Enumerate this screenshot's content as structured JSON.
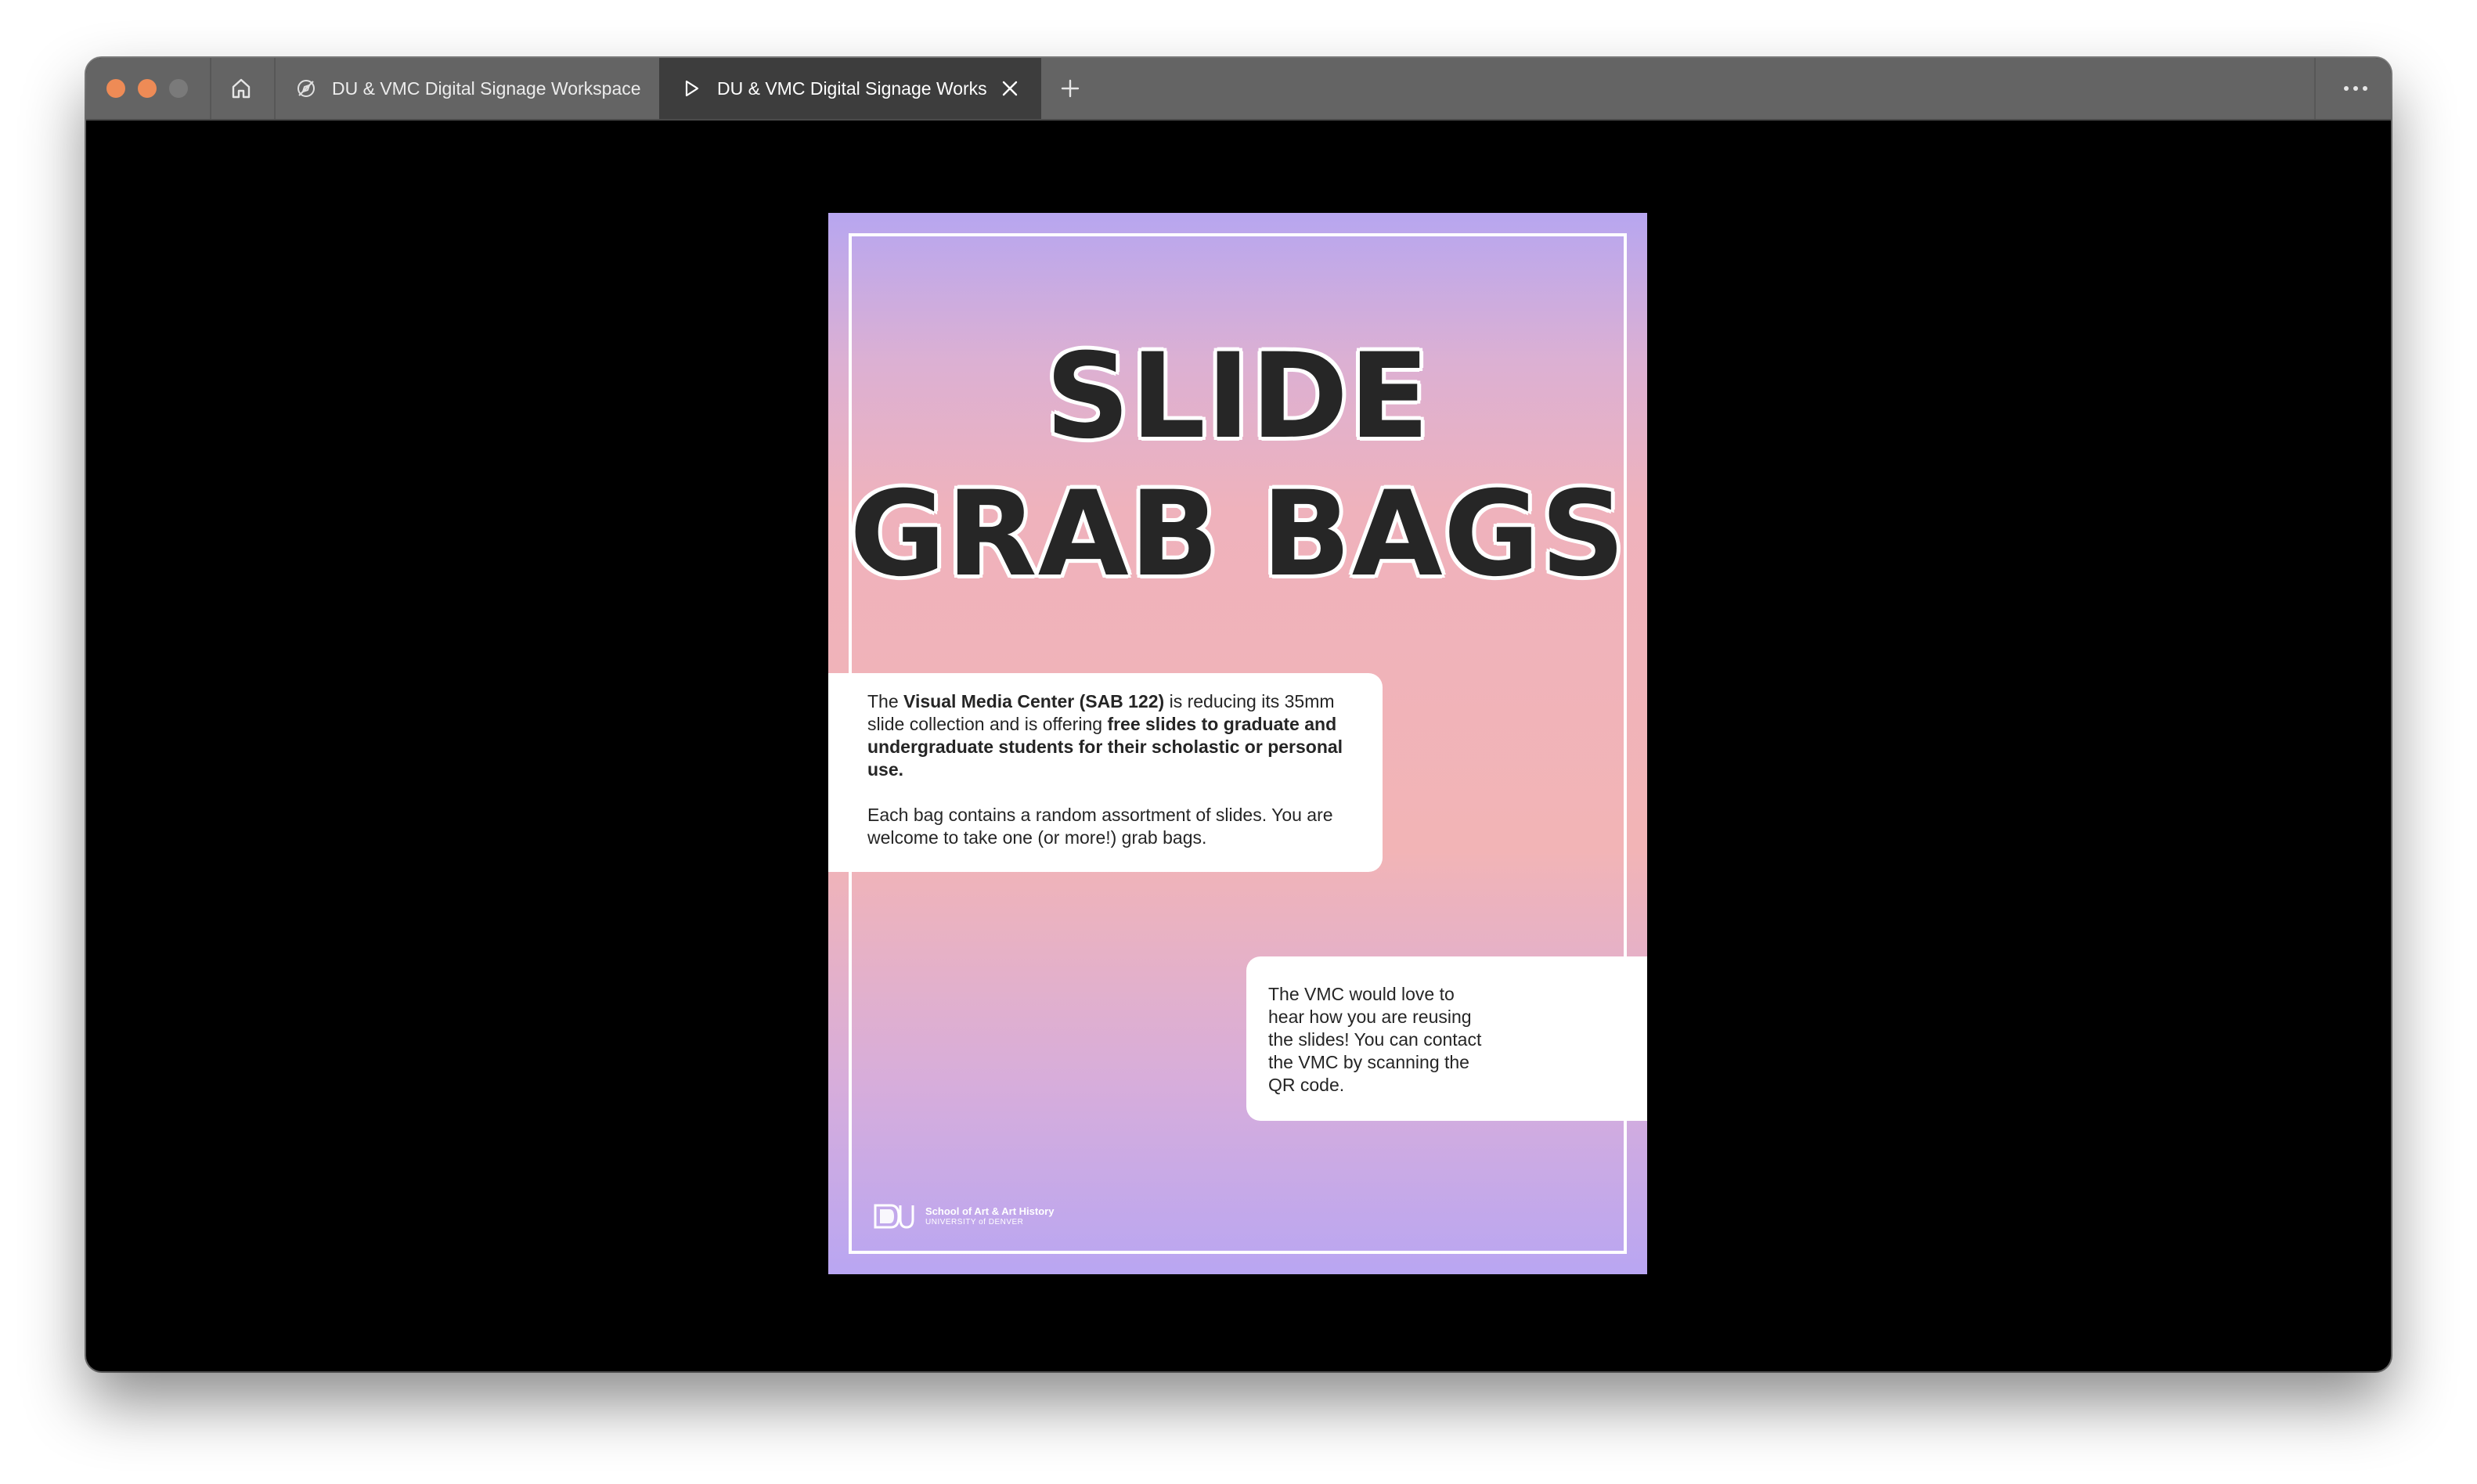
{
  "browser": {
    "tabs": [
      {
        "title": "DU & VMC Digital Signage Workspace",
        "icon": "compass-tab-icon",
        "active": false
      },
      {
        "title": "DU & VMC Digital Signage Workspace",
        "icon": "play-tab-icon",
        "active": true
      }
    ],
    "colors": {
      "titlebar": "#646464",
      "active_tab": "#3d3d3d",
      "close_dot": "#ee8b56"
    }
  },
  "poster": {
    "headline_line1": "SLIDE",
    "headline_line2": "GRAB BAGS",
    "card1": {
      "p1_intro": "The ",
      "p1_vmc": "Visual Media Center (SAB 122)",
      "p1_mid": " is reducing its 35mm slide collection and is offering ",
      "p1_offer": "free slides to graduate and undergraduate students for their scholastic or personal use.",
      "p2": "Each bag contains a random assortment of slides. You are welcome to take one (or more!) grab bags."
    },
    "card2": {
      "text": "The VMC would love to hear how you are reusing the slides! You can contact the VMC by scanning the QR code."
    },
    "logo": {
      "school": "School of Art & Art History",
      "university": "UNIVERSITY of DENVER"
    },
    "colors": {
      "gradient_top": "#b7a6f0",
      "gradient_mid": "#f2b4b6",
      "headline": "#262626"
    }
  }
}
